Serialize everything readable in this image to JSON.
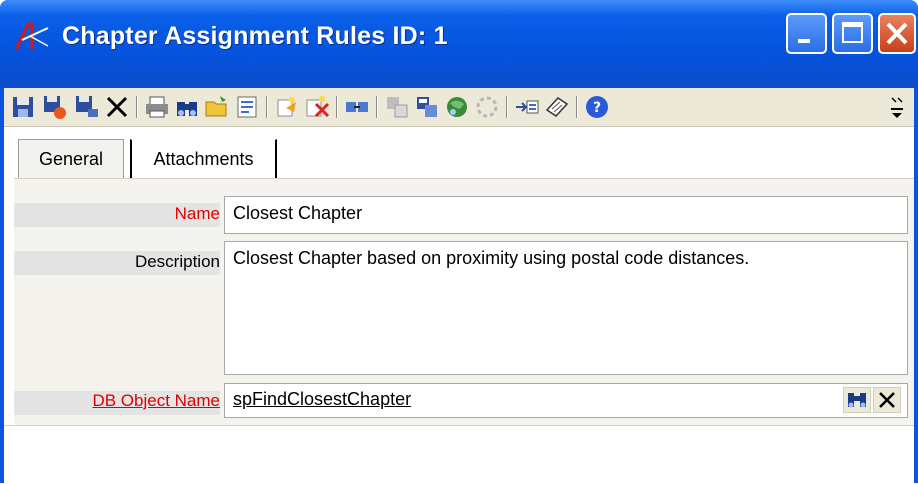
{
  "window": {
    "title": "Chapter Assignment Rules ID: 1",
    "app_icon": "aptify-logo-icon"
  },
  "toolbar": {
    "buttons": [
      "save-icon",
      "save-and-new-icon",
      "save-and-close-icon",
      "delete-icon",
      "print-icon",
      "find-icon",
      "open-folder-icon",
      "view-icon",
      "wizard-icon",
      "clear-icon",
      "link-icon",
      "copy-record-icon",
      "process-flow-icon",
      "web-icon",
      "refresh-icon",
      "go-to-icon",
      "notes-icon",
      "help-icon"
    ]
  },
  "tabs": [
    {
      "label": "General",
      "active": true
    },
    {
      "label": "Attachments",
      "active": false
    }
  ],
  "form": {
    "name_label": "Name",
    "name_value": "Closest Chapter",
    "description_label": "Description",
    "description_value": "Closest Chapter based on proximity using postal code distances.",
    "db_object_label": "DB Object Name",
    "db_object_value": "spFindClosestChapter"
  },
  "colors": {
    "title_bar": "#0653dd",
    "required_label": "#e00000",
    "close_button": "#c8401a"
  }
}
